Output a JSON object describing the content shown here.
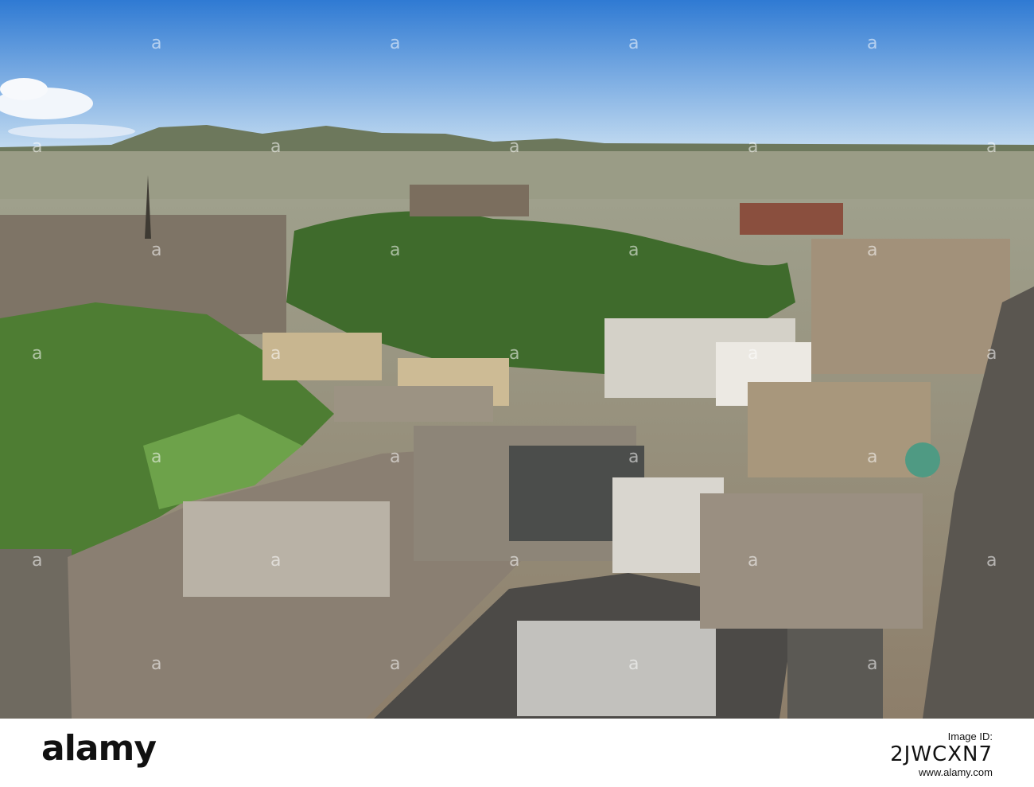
{
  "photo": {
    "subject": "aerial-city-view",
    "watermark_text": "a",
    "colors": {
      "sky_top": "#3f87d6",
      "sky_bottom": "#b9d3ee",
      "hills": "#6f7a5e",
      "trees": "#3d6a2a",
      "stone": "#b59f7e",
      "roof": "#8a8178"
    }
  },
  "footer": {
    "brand": "alamy",
    "image_id_label": "Image ID:",
    "image_id": "2JWCXN7",
    "url": "www.alamy.com"
  }
}
